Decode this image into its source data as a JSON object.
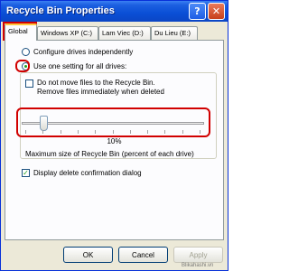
{
  "window": {
    "title": "Recycle Bin Properties",
    "help_label": "?",
    "close_label": "✕"
  },
  "tabs": [
    {
      "label": "Global",
      "active": true
    },
    {
      "label": "Windows XP (C:)",
      "active": false
    },
    {
      "label": "Lam Viec (D:)",
      "active": false
    },
    {
      "label": "Du Lieu (E:)",
      "active": false
    }
  ],
  "global": {
    "configure_independently_label": "Configure drives independently",
    "use_one_setting_label": "Use one setting for all drives:",
    "use_one_setting_selected": true,
    "dont_move_label_line1": "Do not move files to the Recycle Bin.",
    "dont_move_label_line2": "Remove files immediately when deleted",
    "dont_move_checked": false,
    "max_size_percent_text": "10%",
    "max_size_fraction": 0.1,
    "max_size_caption": "Maximum size of Recycle Bin (percent of each drive)",
    "confirm_delete_label": "Display delete confirmation dialog",
    "confirm_delete_checked": true,
    "check_mark": "✓"
  },
  "buttons": {
    "ok": "OK",
    "cancel": "Cancel",
    "apply": "Apply"
  },
  "watermark": "Blikahashi.vn",
  "colors": {
    "titlebar": "#0a4fd6",
    "highlight": "#d10000",
    "window_bg": "#ece9d8"
  }
}
